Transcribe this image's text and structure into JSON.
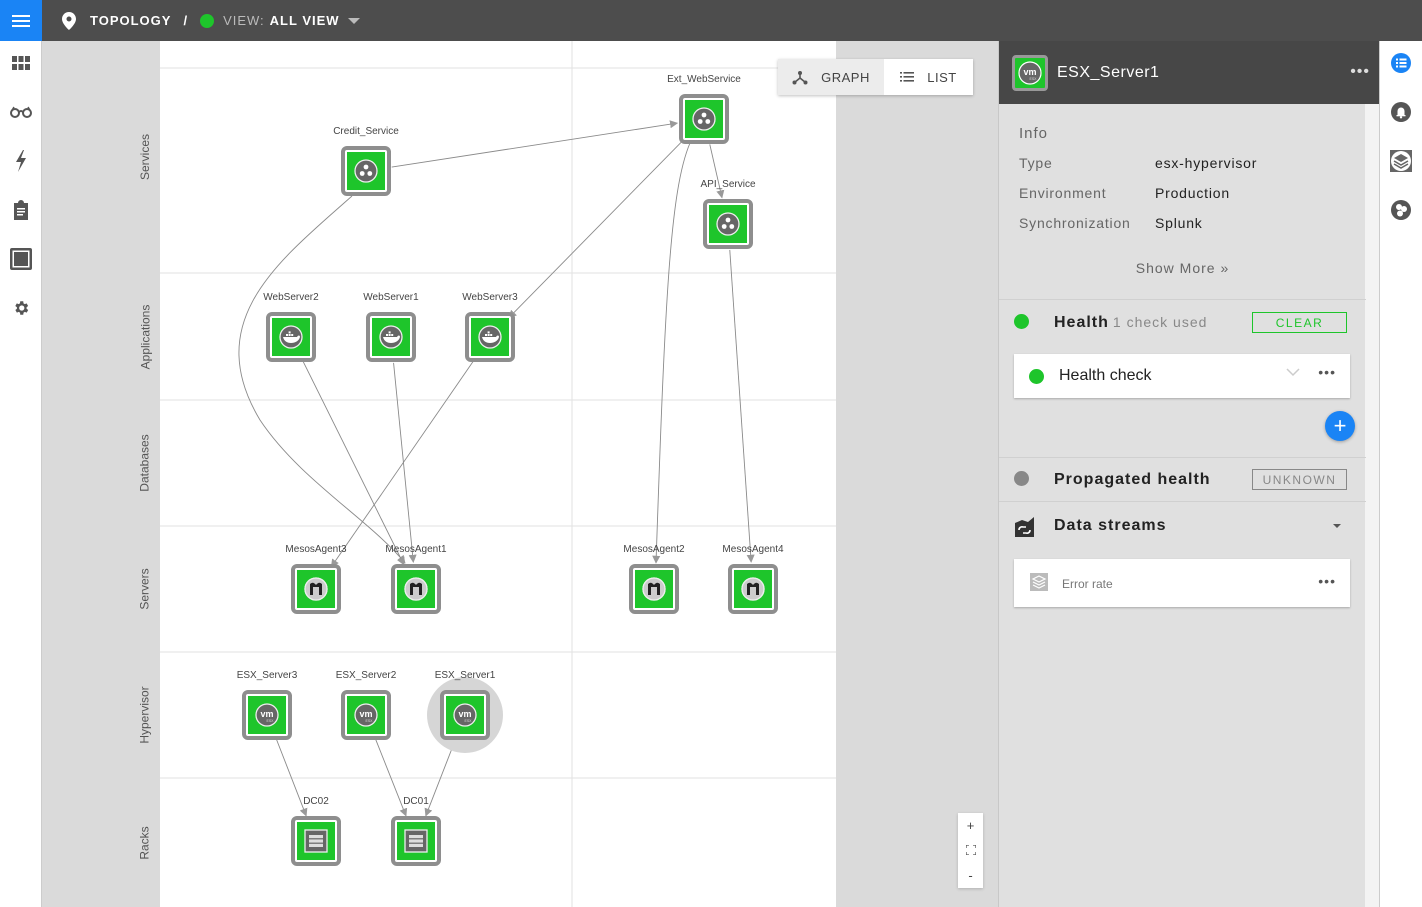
{
  "topbar": {
    "menu_icon": "hamburger-icon",
    "breadcrumb_icon": "map-pin-icon",
    "topology_label": "TOPOLOGY",
    "separator": "/",
    "view_status_color": "#1ec52b",
    "view_prefix": "VIEW:",
    "view_name": "ALL VIEW"
  },
  "leftnav": {
    "items": [
      {
        "name": "dashboard",
        "icon": "grid-icon"
      },
      {
        "name": "explore",
        "icon": "glasses-icon"
      },
      {
        "name": "events",
        "icon": "lightning-icon"
      },
      {
        "name": "checklist",
        "icon": "clipboard-icon"
      },
      {
        "name": "views",
        "icon": "square-icon"
      },
      {
        "name": "settings",
        "icon": "gear-icon"
      }
    ]
  },
  "graph": {
    "view_toggle": {
      "graph_label": "GRAPH",
      "list_label": "LIST",
      "active": "graph"
    },
    "lanes": [
      "Services",
      "Applications",
      "Databases",
      "Servers",
      "Hypervisor",
      "Racks"
    ],
    "nodes": [
      {
        "id": "credit",
        "label": "Credit_Service",
        "type": "service",
        "status": "#1ec52b"
      },
      {
        "id": "extweb",
        "label": "Ext_WebService",
        "type": "service",
        "status": "#1ec52b"
      },
      {
        "id": "api",
        "label": "API_Service",
        "type": "service",
        "status": "#1ec52b"
      },
      {
        "id": "web2",
        "label": "WebServer2",
        "type": "docker",
        "status": "#1ec52b"
      },
      {
        "id": "web1",
        "label": "WebServer1",
        "type": "docker",
        "status": "#1ec52b"
      },
      {
        "id": "web3",
        "label": "WebServer3",
        "type": "docker",
        "status": "#1ec52b"
      },
      {
        "id": "ma3",
        "label": "MesosAgent3",
        "type": "mesos",
        "status": "#1ec52b"
      },
      {
        "id": "ma1",
        "label": "MesosAgent1",
        "type": "mesos",
        "status": "#1ec52b"
      },
      {
        "id": "ma2",
        "label": "MesosAgent2",
        "type": "mesos",
        "status": "#1ec52b"
      },
      {
        "id": "ma4",
        "label": "MesosAgent4",
        "type": "mesos",
        "status": "#1ec52b"
      },
      {
        "id": "esx3",
        "label": "ESX_Server3",
        "type": "vmware",
        "status": "#1ec52b"
      },
      {
        "id": "esx2",
        "label": "ESX_Server2",
        "type": "vmware",
        "status": "#1ec52b"
      },
      {
        "id": "esx1",
        "label": "ESX_Server1",
        "type": "vmware",
        "status": "#1ec52b",
        "selected": true
      },
      {
        "id": "dc02",
        "label": "DC02",
        "type": "rack",
        "status": "#1ec52b"
      },
      {
        "id": "dc01",
        "label": "DC01",
        "type": "rack",
        "status": "#1ec52b"
      }
    ],
    "edges": [
      [
        "credit",
        "extweb"
      ],
      [
        "extweb",
        "api"
      ],
      [
        "extweb",
        "web3"
      ],
      [
        "extweb",
        "ma2"
      ],
      [
        "api",
        "ma4"
      ],
      [
        "credit",
        "ma1"
      ],
      [
        "web2",
        "ma1"
      ],
      [
        "web1",
        "ma1"
      ],
      [
        "web3",
        "ma3"
      ],
      [
        "esx3",
        "dc02"
      ],
      [
        "esx2",
        "dc01"
      ],
      [
        "esx1",
        "dc01"
      ]
    ],
    "zoom_controls": {
      "zoom_in": "+",
      "fit": "fit-screen-icon",
      "zoom_out": "-"
    }
  },
  "panel": {
    "title": "ESX_Server1",
    "more": "•••",
    "info_title": "Info",
    "info": [
      {
        "key": "Type",
        "value": "esx-hypervisor"
      },
      {
        "key": "Environment",
        "value": "Production"
      },
      {
        "key": "Synchronization",
        "value": "Splunk"
      }
    ],
    "show_more": "Show More »",
    "health": {
      "title": "Health",
      "subtitle": "1 check used",
      "status_color": "#1ec52b",
      "badge": "CLEAR",
      "checks": [
        {
          "label": "Health check",
          "status_color": "#1ec52b"
        }
      ],
      "add": "+"
    },
    "propagated": {
      "title": "Propagated health",
      "status_color": "#888888",
      "badge": "UNKNOWN"
    },
    "streams": {
      "title": "Data streams",
      "items": [
        {
          "label": "Error rate"
        }
      ]
    }
  },
  "rail": {
    "items": [
      {
        "name": "properties",
        "icon": "list-icon",
        "active": true
      },
      {
        "name": "alerts",
        "icon": "bell-icon"
      },
      {
        "name": "layers",
        "icon": "layers-icon"
      },
      {
        "name": "components",
        "icon": "cluster-icon"
      }
    ]
  },
  "colors": {
    "accent": "#1a84f5",
    "healthy": "#1ec52b",
    "topbar": "#4d4d4d"
  }
}
